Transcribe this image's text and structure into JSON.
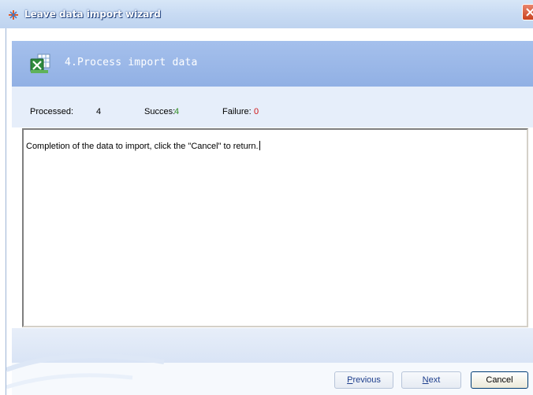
{
  "window": {
    "title": "Leave data import wizard"
  },
  "header": {
    "step_title": "4.Process import data",
    "icon": "excel-import-icon"
  },
  "status": {
    "processed_label": "Processed:",
    "processed_value": "4",
    "success_label": "Succes:",
    "success_value": "4",
    "failure_label": "Failure:",
    "failure_value": "0",
    "colors": {
      "success": "#2e8b20",
      "failure": "#d01414"
    }
  },
  "log": {
    "text": "Completion of the data to import, click the \"Cancel\" to return."
  },
  "buttons": {
    "previous_first": "P",
    "previous_rest": "revious",
    "next_first": "N",
    "next_rest": "ext",
    "cancel": "Cancel"
  },
  "theme": {
    "header_band": "#99b5e6",
    "title_bar": "#c8dbf3",
    "close_button": "#d65a37"
  }
}
